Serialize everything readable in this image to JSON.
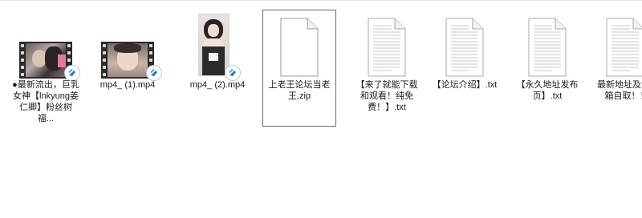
{
  "files": [
    {
      "name": "●最新流出，巨乳女神【lnkyung姜仁卿】粉丝树福...",
      "kind": "video",
      "icon": "video-film-icon"
    },
    {
      "name": "mp4_ (1).mp4",
      "kind": "video",
      "icon": "video-film-icon"
    },
    {
      "name": "mp4_ (2).mp4",
      "kind": "image",
      "icon": "photo-thumbnail"
    },
    {
      "name": "上老王论坛当老王.zip",
      "kind": "zip",
      "icon": "blank-file-icon"
    },
    {
      "name": "【来了就能下载和观看！纯免费！】.txt",
      "kind": "txt",
      "icon": "text-file-icon"
    },
    {
      "name": "【论坛介绍】.txt",
      "kind": "txt",
      "icon": "text-file-icon"
    },
    {
      "name": "【永久地址发布页】.txt",
      "kind": "txt",
      "icon": "text-file-icon"
    },
    {
      "name": "最新地址及请发邮箱自取！！！.",
      "kind": "txt",
      "icon": "text-file-icon"
    }
  ],
  "colors": {
    "selection_border": "#6b6b6b",
    "badge_blue": "#2f74d6",
    "doc_line": "#c9c9c9"
  }
}
